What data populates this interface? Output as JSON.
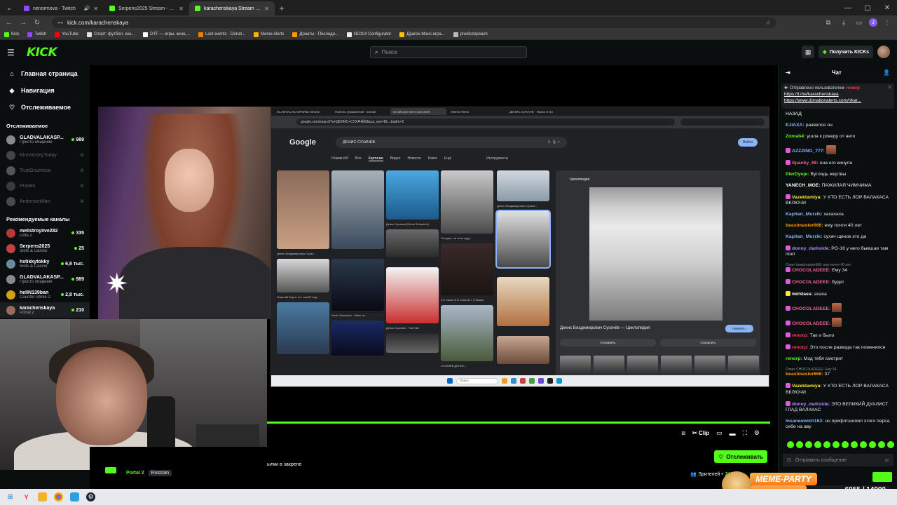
{
  "browser": {
    "tabs": [
      {
        "title": "nenormova - Twitch",
        "color": "#9146ff",
        "active": false,
        "audio": true
      },
      {
        "title": "Serpens2025 Stream - Watch L",
        "color": "#53fc18",
        "active": false,
        "audio": false
      },
      {
        "title": "karachenskaya Stream - Watch",
        "color": "#53fc18",
        "active": true,
        "audio": false
      }
    ],
    "url": "kick.com/karachenskaya",
    "bookmarks": [
      {
        "label": "Kick",
        "color": "#53fc18"
      },
      {
        "label": "Twitch",
        "color": "#9146ff"
      },
      {
        "label": "YouTube",
        "color": "#ff0000"
      },
      {
        "label": "Спорт: футбол, хок...",
        "color": "#e0e0e0"
      },
      {
        "label": "DTF — игры, кино,...",
        "color": "#ffffff"
      },
      {
        "label": "Last events - Donat...",
        "color": "#f57c00"
      },
      {
        "label": "Meme Alerts",
        "color": "#ffb300"
      },
      {
        "label": "Донаты - Последн...",
        "color": "#ff9800"
      },
      {
        "label": "ND104 Configurator",
        "color": "#eeeeee"
      },
      {
        "label": "Драгон Мэнс игра...",
        "color": "#ffc107"
      },
      {
        "label": "prediszepeach",
        "color": "#bbbbbb"
      }
    ],
    "profile_initial": "J"
  },
  "header": {
    "logo": "KICK",
    "search_placeholder": "Поиск",
    "get_kicks_label": "Получить KICKs"
  },
  "sidebar": {
    "nav": [
      {
        "label": "Главная страница",
        "icon": "home-icon",
        "glyph": "⌂"
      },
      {
        "label": "Навигация",
        "icon": "compass-icon",
        "glyph": "◈"
      },
      {
        "label": "Отслеживаемое",
        "icon": "heart-icon",
        "glyph": "♡"
      }
    ],
    "followed_title": "Отслеживаемое",
    "followed": [
      {
        "name": "GLADVALAKASP...",
        "category": "Просто общение",
        "viewers": "989",
        "online": true,
        "color": "#8a8a8a"
      },
      {
        "name": "KhovanskyToday",
        "category": "",
        "viewers": "",
        "online": false,
        "color": "#444"
      },
      {
        "name": "TrueGruztnica",
        "category": "",
        "viewers": "",
        "online": false,
        "color": "#555"
      },
      {
        "name": "Praden",
        "category": "",
        "viewers": "",
        "online": false,
        "color": "#3a3a3a"
      },
      {
        "name": "AndersonMan",
        "category": "",
        "viewers": "",
        "online": false,
        "color": "#4a4a4a"
      }
    ],
    "recommended_title": "Рекомендуемые каналы",
    "recommended": [
      {
        "name": "mellstroylive282",
        "category": "Dota 2",
        "viewers": "335",
        "color": "#b23a3a"
      },
      {
        "name": "Serpens2025",
        "category": "Slots & Casino",
        "viewers": "25",
        "color": "#c24242"
      },
      {
        "name": "hstikkytokky",
        "category": "Slots & Casino",
        "viewers": "6,8 тыс.",
        "color": "#6a8aa0"
      },
      {
        "name": "GLADVALAKASP...",
        "category": "Просто общение",
        "viewers": "989",
        "color": "#8a8a8a"
      },
      {
        "name": "hellN139ban",
        "category": "Counter-Strike 2",
        "viewers": "2,8 тыс.",
        "color": "#d4a017"
      },
      {
        "name": "karachenskaya",
        "category": "Portal 2",
        "viewers": "210",
        "color": "#9a6b5a",
        "active": true
      }
    ]
  },
  "screen": {
    "tabs": [
      "GLADVALAKASPWNZ Stream",
      "Панель управления - Donati",
      "китайская ивентора 2026",
      "Meme Alerts",
      "ДЕНИС СУХАЧЕ - Поиск в Go"
    ],
    "url": "google.com/search?q=ДЕНИС+СУХАЧЁВ&sca_esv=8b...&udm=2",
    "google_logo": "Google",
    "query": "ДЕНИС СУХАЧЕВ",
    "signin": "Войти",
    "filters": [
      "Режим ИИ",
      "Все",
      "Картинки",
      "Видео",
      "Новости",
      "Книги",
      "Ещё"
    ],
    "active_filter": "Картинки",
    "tools": "Инструменты",
    "panel_source": "Циклопедия",
    "panel_title": "Денис Владимирович Сухачёв — Циклопедия",
    "panel_goto": "Перейти ›",
    "panel_share": "Отправить",
    "panel_save": "Сохранить",
    "taskbar_search": "Поиск",
    "captions": [
      "Денис Владимирович Сухач...",
      "Денис Сухачев (Denis Suhachev)",
      "Сегодня, на этом труд...",
      "Денис Владимирович Сухачё...",
      "Повалий Борис это такой Глад...",
      "Denis Suhachev - Miner at...",
      "Кто такой этот капитан? | Пикабу",
      "Денис Сухачев - YouTube",
      "СУХАЧЁВ ДЕНИС..."
    ]
  },
  "player": {
    "clip_label": "Clip",
    "progress": 1.0
  },
  "stream": {
    "pinned_text": "ылки в закрепе",
    "category": "Portal 2",
    "language": "Russian",
    "follow_label": "Отслеживать",
    "viewers_label": "Зрителей •",
    "viewers_count": "210"
  },
  "chat": {
    "title": "Чат",
    "pinned_by": "Отправлено пользователем",
    "pinned_nick": "renorp",
    "pinned_links": [
      "https://t.me/karachenskaya",
      "https://www.donationalerts.com/r/kar..."
    ],
    "messages": [
      {
        "nick": "",
        "text": "НАЗАД",
        "color": "#ffffff",
        "badge": ""
      },
      {
        "nick": "EJIAXA:",
        "text": " развелся он",
        "color": "#8ab4f8",
        "badge": ""
      },
      {
        "nick": "Zomab4:",
        "text": " ушла к рокеру от него",
        "color": "#53fc18",
        "badge": ""
      },
      {
        "nick": "AZZZINO_777:",
        "text": "",
        "color": "#8ab4f8",
        "badge": "#e05adb",
        "emote": true
      },
      {
        "nick": "Spanky_66:",
        "text": " она его кинула",
        "color": "#f06292",
        "badge": "#e05adb"
      },
      {
        "nick": "PierDyoje:",
        "text": " Вуглядь жертвы",
        "color": "#53fc18",
        "badge": ""
      },
      {
        "nick": "YANECH_MOE:",
        "text": " ПАЖИЛАЯ ЧИМЧИМА",
        "color": "#ffffff",
        "badge": ""
      },
      {
        "nick": "Vazektamiya:",
        "text": " У ХТО ЕСТЬ ЛОР ВАЛАКАСА ВКЛЮЧИ",
        "color": "#ffeb3b",
        "badge": "#e05adb"
      },
      {
        "nick": "Kapitan_Murzik:",
        "text": " хахахаха",
        "color": "#8ab4f8",
        "badge": ""
      },
      {
        "nick": "beastmaster666:",
        "text": " ему почти 40 лет",
        "color": "#ff9800",
        "badge": ""
      },
      {
        "nick": "Kapitan_Murzik:",
        "text": " сухач щенок это да",
        "color": "#8ab4f8",
        "badge": ""
      },
      {
        "nick": "donny_darkside:",
        "text": " PG-16 у него бывшая там поет",
        "color": "#b388ff",
        "badge": "#e05adb"
      },
      {
        "reply": "Ответ beastmaster666: ему почти 40 лет",
        "nick": "CHOCOLADEEE:",
        "text": " Ему 34",
        "color": "#f06292",
        "badge": "#e05adb"
      },
      {
        "nick": "CHOCOLADEEE:",
        "text": " будет",
        "color": "#f06292",
        "badge": "#e05adb"
      },
      {
        "nick": "mirklass:",
        "text": " ахаха",
        "color": "#ffffff",
        "badge": "#ffeb3b"
      },
      {
        "nick": "CHOCOLADEEE:",
        "text": "",
        "color": "#f06292",
        "badge": "#e05adb",
        "emote": true
      },
      {
        "nick": "CHOCOLADEEE:",
        "text": "",
        "color": "#f06292",
        "badge": "#e05adb",
        "emote": true
      },
      {
        "nick": "renorp:",
        "text": " Так и было",
        "color": "#ff3d5a",
        "badge": "#e05adb"
      },
      {
        "nick": "renorp:",
        "text": " Это после развода так поменялся",
        "color": "#ff3d5a",
        "badge": "#e05adb"
      },
      {
        "nick": "renorp:",
        "text": " Мэд тебя смотрит",
        "color": "#53fc18",
        "badge": ""
      },
      {
        "reply": "Ответ CHOCOLADEEE: Ему 34",
        "nick": "beastmaster666:",
        "text": " 37",
        "color": "#ff9800",
        "badge": ""
      },
      {
        "nick": "Vazektamiya:",
        "text": " У ХТО ЕСТЬ ЛОР ВАЛАКАСА ВКЛЮЧИ",
        "color": "#ffeb3b",
        "badge": "#e05adb"
      },
      {
        "nick": "donny_darkside:",
        "text": " ЭТО ВЕЛИКИЙ ДУАЛИСТ ГЛАД ВАЛАКАС",
        "color": "#b388ff",
        "badge": "#e05adb"
      },
      {
        "nick": "Insaneowich163:",
        "text": " он прифотшопил этого перса себе на аву",
        "color": "#8ab4f8",
        "badge": ""
      }
    ],
    "input_placeholder": "Отправить сообщение"
  },
  "overlay": {
    "title": "MEME-PARTY",
    "count": "6055 / 14900",
    "fraction": 0.406
  }
}
